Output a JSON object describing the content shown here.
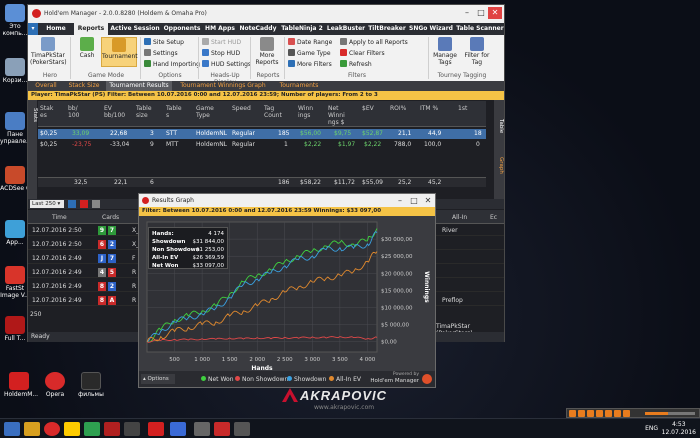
{
  "desktop": {
    "icons": [
      {
        "label": "Это компь...",
        "color": "#5b8fd6"
      },
      {
        "label": "Корзи...",
        "color": "#8aa0b8"
      },
      {
        "label": "Пане управле...",
        "color": "#4a7dc4"
      },
      {
        "label": "ACDSee 6",
        "color": "#c84a2a"
      },
      {
        "label": "App...",
        "color": "#3ea0d8"
      },
      {
        "label": "FastSt Image V...",
        "color": "#d8342a"
      },
      {
        "label": "Full T...",
        "color": "#b01818"
      }
    ],
    "bottom_icons": [
      {
        "label": "HoldemM...",
        "color": "#d32020"
      },
      {
        "label": "Opera",
        "color": "#d82a2a"
      },
      {
        "label": "фильмы",
        "color": "#2a2a2a"
      }
    ],
    "wallpaper_brand": "AKRAPOVIC",
    "wallpaper_url": "www.akrapovic.com"
  },
  "taskbar": {
    "language": "ENG",
    "time": "4:53",
    "date": "12.07.2016"
  },
  "media_player": {
    "progress": 0.45
  },
  "main_window": {
    "title": "Hold'em Manager - 2.0.0.8280 (Holdem & Omaha Pro)",
    "menu": [
      "Home",
      "Reports",
      "Active Session",
      "Opponents",
      "HM Apps",
      "NoteCaddy",
      "TableNinja 2",
      "LeakBuster",
      "TiltBreaker",
      "SNGo Wizard",
      "Table Scanner"
    ],
    "ribbon": {
      "hero_label": "TimaPkStar (PokerStars)",
      "cash_label": "Cash",
      "tournament_label": "Tournament",
      "site_setup": "Site Setup",
      "settings": "Settings",
      "hand_importing": "Hand Importing",
      "start_hud": "Start HUD",
      "stop_hud": "Stop HUD",
      "hud_settings": "HUD Settings",
      "more_reports": "More Reports",
      "date_range": "Date Range",
      "game_type": "Game Type",
      "more_filters": "More Filters",
      "apply_all": "Apply to all Reports",
      "clear_filters": "Clear Filters",
      "refresh": "Refresh",
      "manage_tags": "Manage Tags",
      "filter_for_tag": "Filter for Tag",
      "groups": [
        "Hero",
        "Game Mode",
        "Options",
        "Heads-Up Display",
        "Reports",
        "Filters",
        "Tourney Tagging"
      ]
    },
    "subtabs": [
      "Overall",
      "Stack Size",
      "Tournament Results",
      "Tournament Winnings Graph",
      "Tournaments"
    ],
    "filter_text": "Player: TimaPkStar (PS)  Filter: Between 10.07.2016 0:00 and 12.07.2016 23:59; Number of players: From 2 to 3",
    "side_tabs": [
      "Table",
      "Graph"
    ],
    "left_tab": "Stats",
    "grid": {
      "headers": [
        "Stak es",
        "bb/ 100",
        "EV bb/100",
        "Table size",
        "Table s",
        "Game Type",
        "Speed",
        "Tag Count",
        "Winn ings",
        "Net Winni ngs $",
        "$EV",
        "ROI%",
        "ITM %",
        "1st"
      ],
      "rows": [
        [
          "$0,25",
          "33,09",
          "22,68",
          "3",
          "STT",
          "HoldemNL",
          "Regular",
          "185",
          "$56,00",
          "$9,75",
          "$52,87",
          "21,1",
          "44,9",
          "18"
        ],
        [
          "$0,25",
          "-23,75",
          "-33,04",
          "9",
          "MTT",
          "HoldemNL",
          "Regular",
          "1",
          "$2,22",
          "$1,97",
          "$2,22",
          "788,0",
          "100,0",
          "0"
        ]
      ],
      "totals": [
        "32,5",
        "22,1",
        "6",
        "186",
        "$58,22",
        "$11,72",
        "$55,09",
        "25,2",
        "45,2"
      ]
    },
    "lower": {
      "dropdown": "Last 250",
      "headers": [
        "Time",
        "Cards",
        "All-In",
        "Ec"
      ],
      "rows": [
        {
          "time": "12.07.2016 2:50",
          "cards": [
            "9",
            "7"
          ],
          "colors": [
            "c-green",
            "c-green"
          ],
          "pos": "X_",
          "allin": "River"
        },
        {
          "time": "12.07.2016 2:50",
          "cards": [
            "6",
            "2"
          ],
          "colors": [
            "c-red",
            "c-blue"
          ],
          "pos": "X_",
          "allin": ""
        },
        {
          "time": "12.07.2016 2:49",
          "cards": [
            "J",
            "7"
          ],
          "colors": [
            "c-blue",
            "c-blue"
          ],
          "pos": "F",
          "allin": ""
        },
        {
          "time": "12.07.2016 2:49",
          "cards": [
            "4",
            "5"
          ],
          "colors": [
            "c-grey",
            "c-red"
          ],
          "pos": "R",
          "allin": ""
        },
        {
          "time": "12.07.2016 2:49",
          "cards": [
            "8",
            "2"
          ],
          "colors": [
            "c-red",
            "c-blue"
          ],
          "pos": "R",
          "allin": ""
        },
        {
          "time": "12.07.2016 2:49",
          "cards": [
            "8",
            "A"
          ],
          "colors": [
            "c-red",
            "c-red"
          ],
          "pos": "R",
          "allin": "Preflop"
        }
      ],
      "page_value": "250",
      "player_label": "TimaPkStar (PokerStars)"
    },
    "status": "Ready"
  },
  "results_graph": {
    "title": "Results Graph",
    "filter_text": "Filter: Between 10.07.2016 0:00 and 12.07.2016 23:59  Winnings: $33 097,00",
    "stats": [
      {
        "k": "Hands:",
        "v": "4 174"
      },
      {
        "k": "Showdown",
        "v": "$31 844,00"
      },
      {
        "k": "Non Showdown",
        "v": "$1 253,00"
      },
      {
        "k": "All-In EV",
        "v": "$26 369,59"
      },
      {
        "k": "Net Won",
        "v": "$33 097,00"
      }
    ],
    "options_label": "Options",
    "powered_by": "Powered by",
    "brand": "Hold'em Manager"
  },
  "chart_data": {
    "type": "line",
    "title": "",
    "xlabel": "Hands",
    "ylabel": "Winnings",
    "xlim": [
      0,
      4174
    ],
    "ylim": [
      -3000,
      35000
    ],
    "x_ticks": [
      "500",
      "1 000",
      "1 500",
      "2 000",
      "2 500",
      "3 000",
      "3 500",
      "4 000"
    ],
    "y_ticks": [
      "$0,00",
      "$5 000,00",
      "$10 000,00",
      "$15 000,00",
      "$20 000,00",
      "$25 000,00",
      "$30 000,00"
    ],
    "x": [
      0,
      250,
      500,
      750,
      1000,
      1250,
      1500,
      1750,
      2000,
      2250,
      2500,
      2750,
      3000,
      3250,
      3500,
      3750,
      4000,
      4174
    ],
    "series": [
      {
        "name": "Net Won",
        "color": "#3fcf3f",
        "values": [
          0,
          3500,
          6500,
          7500,
          9000,
          10500,
          14000,
          17500,
          19500,
          21000,
          23500,
          25000,
          26500,
          28000,
          29000,
          28500,
          29500,
          33097
        ]
      },
      {
        "name": "Non Showdown",
        "color": "#e04848",
        "values": [
          0,
          400,
          700,
          500,
          900,
          700,
          1100,
          800,
          1200,
          900,
          1300,
          1000,
          1400,
          1100,
          1500,
          1200,
          900,
          1253
        ]
      },
      {
        "name": "Showdown",
        "color": "#3aa0e0",
        "values": [
          0,
          3100,
          5800,
          7000,
          8100,
          9800,
          12900,
          16700,
          18300,
          20100,
          22200,
          24000,
          25100,
          26900,
          27500,
          27300,
          28600,
          31844
        ]
      },
      {
        "name": "All-In EV",
        "color": "#e0892e",
        "values": [
          0,
          1500,
          3000,
          4200,
          5000,
          5800,
          7500,
          9000,
          10500,
          12500,
          14500,
          16000,
          17500,
          18500,
          19500,
          20500,
          23500,
          26370
        ]
      }
    ],
    "legend_position": "bottom"
  }
}
